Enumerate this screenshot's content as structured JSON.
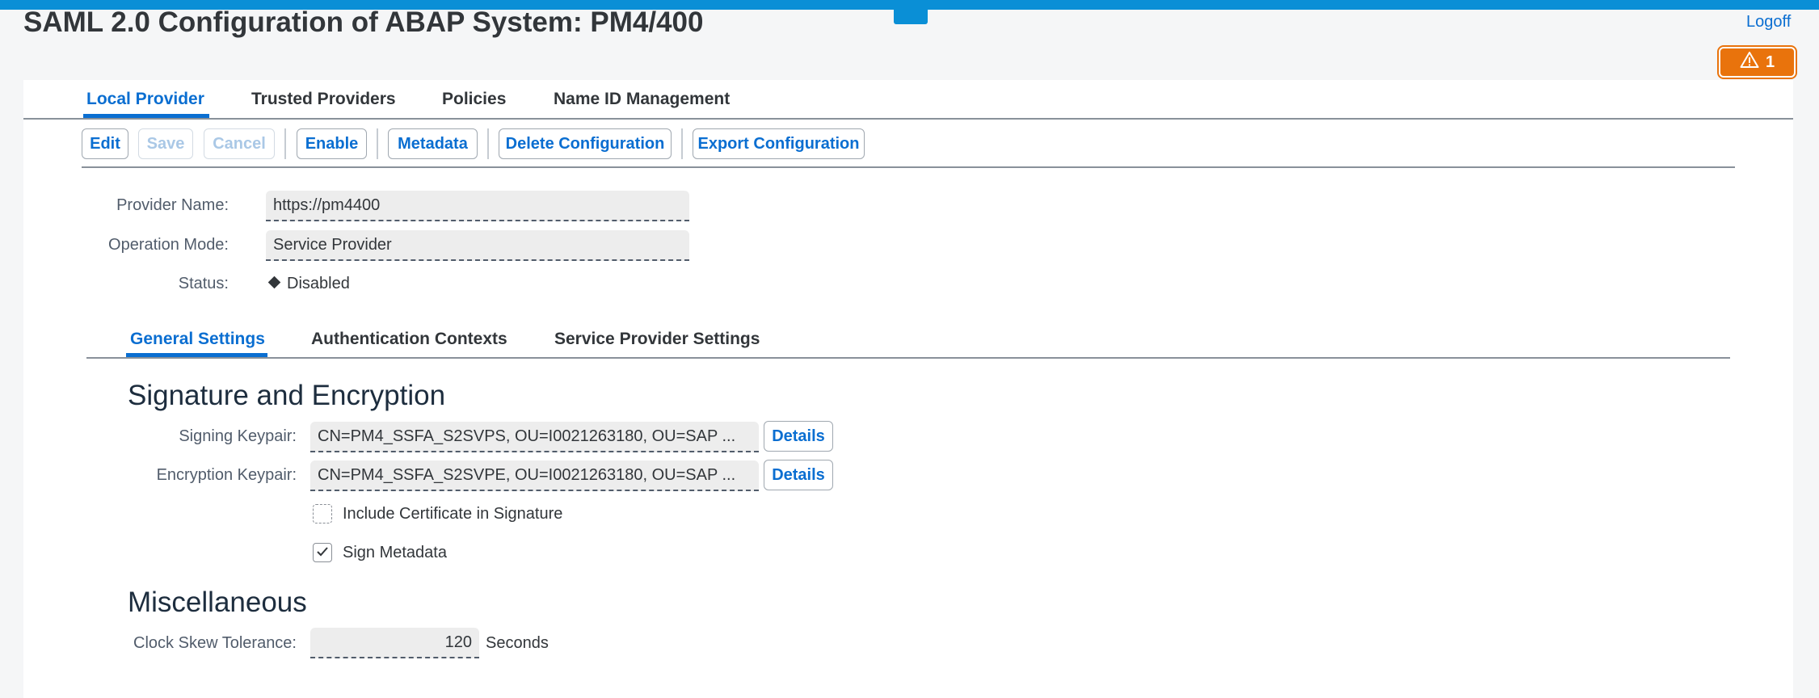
{
  "header": {
    "title": "SAML 2.0 Configuration of ABAP System: PM4/400",
    "logoff_label": "Logoff",
    "warning_count": "1"
  },
  "main_tabs": [
    {
      "label": "Local Provider",
      "active": true
    },
    {
      "label": "Trusted Providers"
    },
    {
      "label": "Policies"
    },
    {
      "label": "Name ID Management"
    }
  ],
  "toolbar": {
    "edit": "Edit",
    "save": "Save",
    "cancel": "Cancel",
    "enable": "Enable",
    "metadata": "Metadata",
    "delete": "Delete Configuration",
    "export": "Export Configuration"
  },
  "provider": {
    "name_label": "Provider Name:",
    "name_value": "https://pm4400",
    "mode_label": "Operation Mode:",
    "mode_value": "Service Provider",
    "status_label": "Status:",
    "status_value": "Disabled"
  },
  "sub_tabs": [
    {
      "label": "General Settings",
      "active": true
    },
    {
      "label": "Authentication Contexts"
    },
    {
      "label": "Service Provider Settings"
    }
  ],
  "signature": {
    "title": "Signature and Encryption",
    "signing_label": "Signing Keypair:",
    "signing_value": "CN=PM4_SSFA_S2SVPS, OU=I0021263180, OU=SAP ...",
    "encryption_label": "Encryption Keypair:",
    "encryption_value": "CN=PM4_SSFA_S2SVPE, OU=I0021263180, OU=SAP ...",
    "details_label": "Details",
    "include_cert_label": "Include Certificate in Signature",
    "include_cert_checked": false,
    "sign_metadata_label": "Sign Metadata",
    "sign_metadata_checked": true
  },
  "misc": {
    "title": "Miscellaneous",
    "clock_label": "Clock Skew Tolerance:",
    "clock_value": "120",
    "clock_unit": "Seconds"
  },
  "colors": {
    "accent": "#0a6ed1",
    "topbar": "#0a8fd6",
    "warning": "#e9730c"
  }
}
